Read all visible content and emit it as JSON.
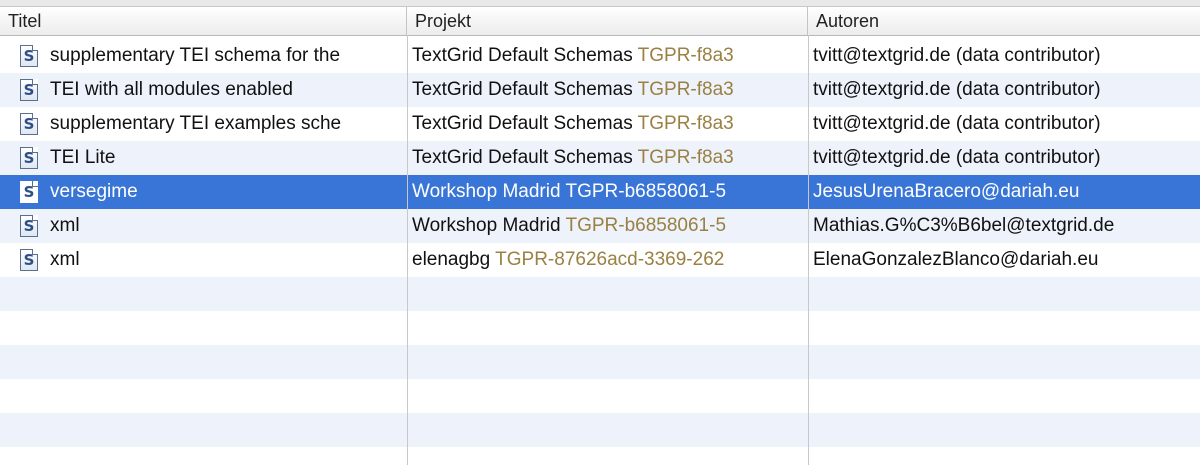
{
  "columns": [
    "Titel",
    "Projekt",
    "Autoren"
  ],
  "rows": [
    {
      "title": "supplementary TEI schema for the",
      "project": "TextGrid Default Schemas",
      "project_id": "TGPR-f8a3",
      "author": "tvitt@textgrid.de (data contributor)",
      "icon": "S"
    },
    {
      "title": "TEI with all modules enabled",
      "project": "TextGrid Default Schemas",
      "project_id": "TGPR-f8a3",
      "author": "tvitt@textgrid.de (data contributor)",
      "icon": "S"
    },
    {
      "title": "supplementary TEI examples sche",
      "project": "TextGrid Default Schemas",
      "project_id": "TGPR-f8a3",
      "author": "tvitt@textgrid.de (data contributor)",
      "icon": "S"
    },
    {
      "title": "TEI Lite",
      "project": "TextGrid Default Schemas",
      "project_id": "TGPR-f8a3",
      "author": "tvitt@textgrid.de (data contributor)",
      "icon": "S"
    },
    {
      "title": "versegime",
      "project": "Workshop Madrid",
      "project_id": "TGPR-b6858061-5",
      "author": "JesusUrenaBracero@dariah.eu",
      "icon": "S",
      "selected": true
    },
    {
      "title": "xml",
      "project": "Workshop Madrid",
      "project_id": "TGPR-b6858061-5",
      "author": "Mathias.G%C3%B6bel@textgrid.de",
      "icon": "S"
    },
    {
      "title": "xml",
      "project": "elenagbg",
      "project_id": "TGPR-87626acd-3369-262",
      "author": "ElenaGonzalezBlanco@dariah.eu",
      "icon": "S"
    }
  ],
  "colors": {
    "selection": "#3875d7",
    "stripe": "#edf2fb",
    "project_id": "#9a8042"
  },
  "icon_name": "schema-file-icon"
}
